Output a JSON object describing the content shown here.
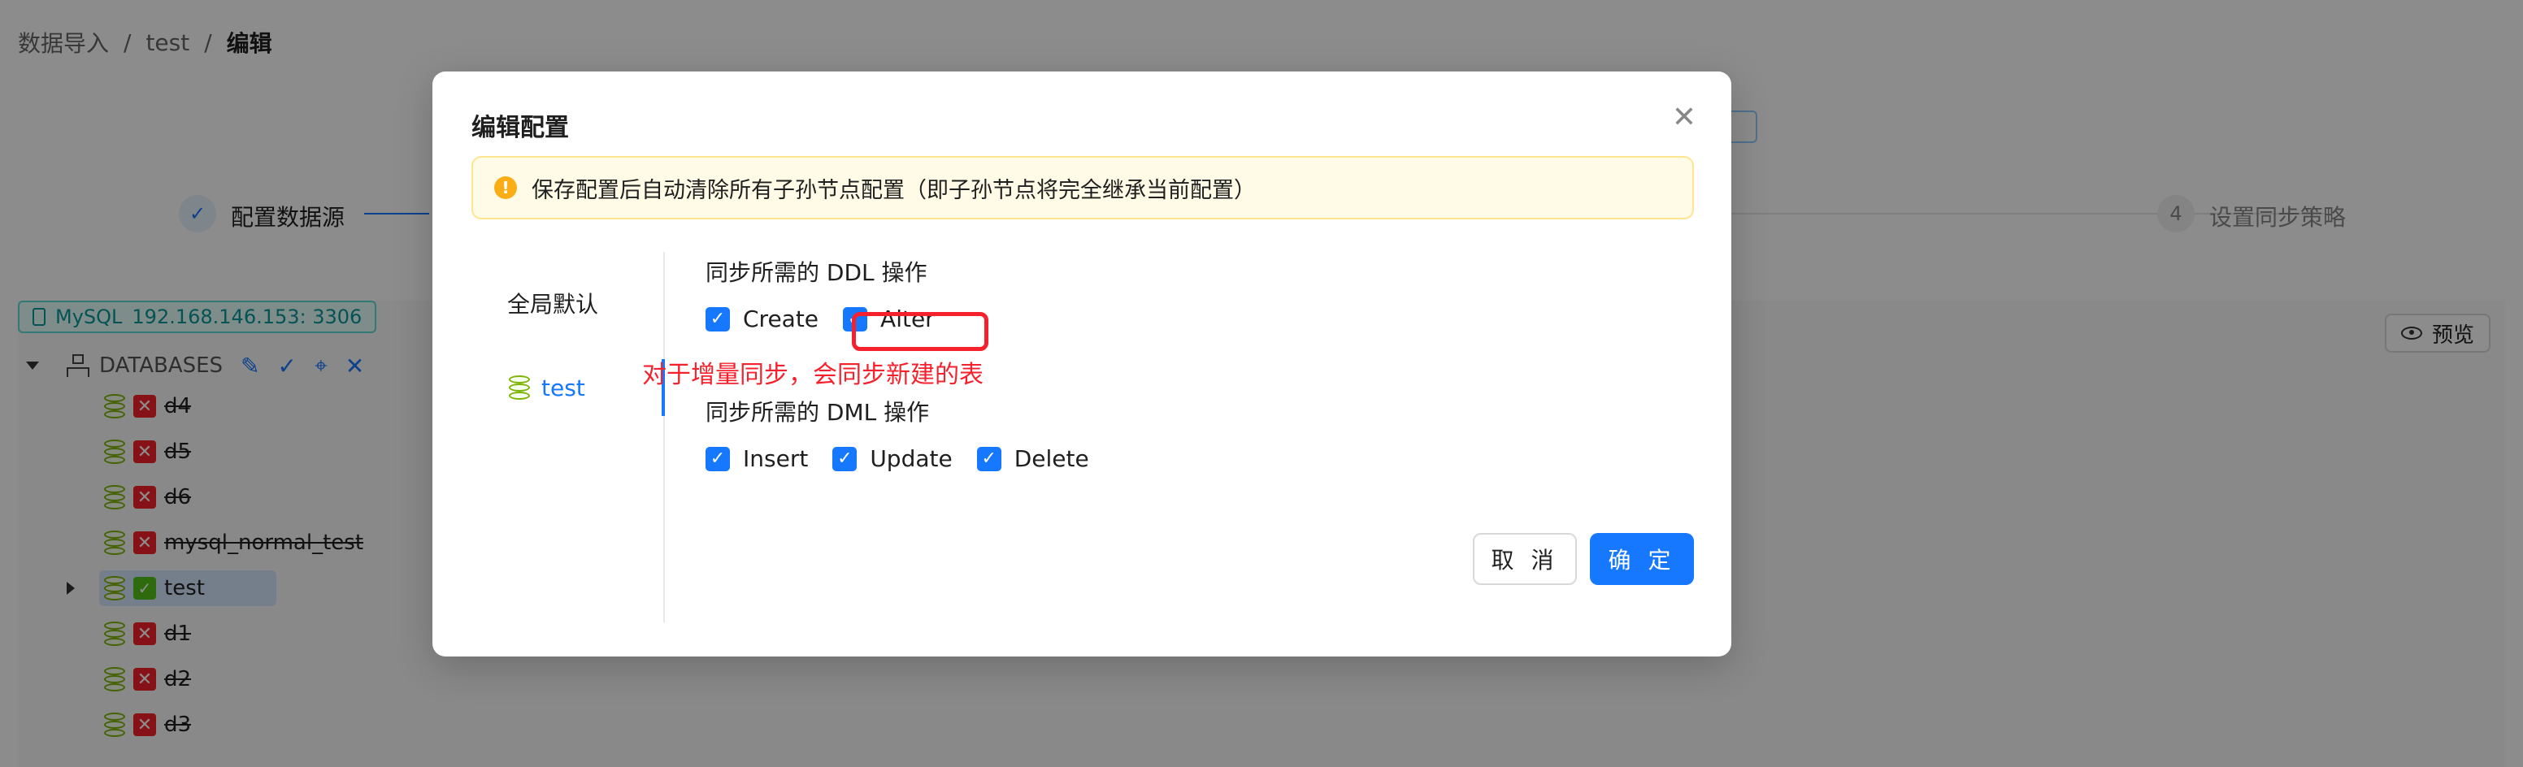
{
  "breadcrumb": {
    "items": [
      "数据导入",
      "test"
    ],
    "separator": "/",
    "current": "编辑"
  },
  "steps": {
    "step1": {
      "icon": "check-icon",
      "label": "配置数据源"
    },
    "step4": {
      "number": "4",
      "label": "设置同步策略"
    }
  },
  "connection": {
    "type": "MySQL",
    "address": "192.168.146.153: 3306"
  },
  "tree": {
    "root_label": "DATABASES",
    "items": [
      {
        "name": "d4",
        "status": "excluded"
      },
      {
        "name": "d5",
        "status": "excluded"
      },
      {
        "name": "d6",
        "status": "excluded"
      },
      {
        "name": "mysql_normal_test",
        "status": "excluded"
      },
      {
        "name": "test",
        "status": "included"
      },
      {
        "name": "d1",
        "status": "excluded"
      },
      {
        "name": "d2",
        "status": "excluded"
      },
      {
        "name": "d3",
        "status": "excluded"
      }
    ]
  },
  "preview": {
    "label": "预览"
  },
  "modal": {
    "title": "编辑配置",
    "alert_text": "保存配置后自动清除所有子孙节点配置（即子孙节点将完全继承当前配置）",
    "nav": {
      "global": "全局默认",
      "test": "test"
    },
    "ddl": {
      "title": "同步所需的 DDL 操作",
      "options": [
        "Create",
        "Alter"
      ]
    },
    "dml": {
      "title": "同步所需的 DML 操作",
      "options": [
        "Insert",
        "Update",
        "Delete"
      ]
    },
    "annotation": "对于增量同步，会同步新建的表",
    "cancel_label": "取 消",
    "ok_label": "确 定"
  },
  "colors": {
    "primary": "#1677ff",
    "danger": "#f5222d",
    "success": "#52c41a",
    "warning": "#faad14"
  }
}
